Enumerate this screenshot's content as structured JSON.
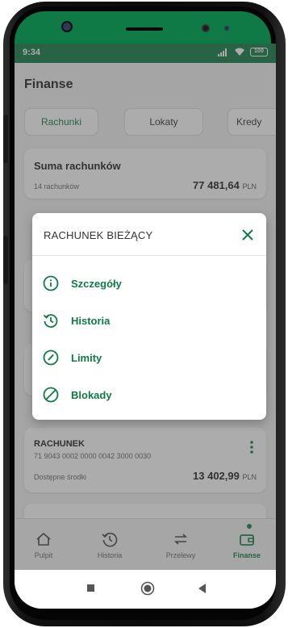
{
  "status_bar": {
    "time": "9:34",
    "battery": "100"
  },
  "page": {
    "title": "Finanse"
  },
  "tabs": [
    {
      "label": "Rachunki",
      "active": true
    },
    {
      "label": "Lokaty",
      "active": false
    },
    {
      "label": "Kredy",
      "active": false
    }
  ],
  "summary": {
    "title": "Suma rachunków",
    "count": "14 rachunków",
    "amount": "77 481,64",
    "currency": "PLN"
  },
  "account": {
    "name": "RACHUNEK",
    "number": "71 9043 0002 0000 0042 3000 0030",
    "balance_label": "Dostępne środki",
    "balance": "13 402,99",
    "currency": "PLN"
  },
  "modal": {
    "title": "RACHUNEK BIEŻĄCY",
    "items": [
      {
        "label": "Szczegóły",
        "icon": "info-icon"
      },
      {
        "label": "Historia",
        "icon": "history-icon"
      },
      {
        "label": "Limity",
        "icon": "gauge-icon"
      },
      {
        "label": "Blokady",
        "icon": "block-icon"
      }
    ]
  },
  "bottom_nav": [
    {
      "label": "Pulpit",
      "icon": "home-icon"
    },
    {
      "label": "Historia",
      "icon": "history-icon"
    },
    {
      "label": "Przelewy",
      "icon": "transfer-icon"
    },
    {
      "label": "Finanse",
      "icon": "wallet-icon",
      "active": true
    }
  ],
  "colors": {
    "brand": "#0f7a45"
  }
}
